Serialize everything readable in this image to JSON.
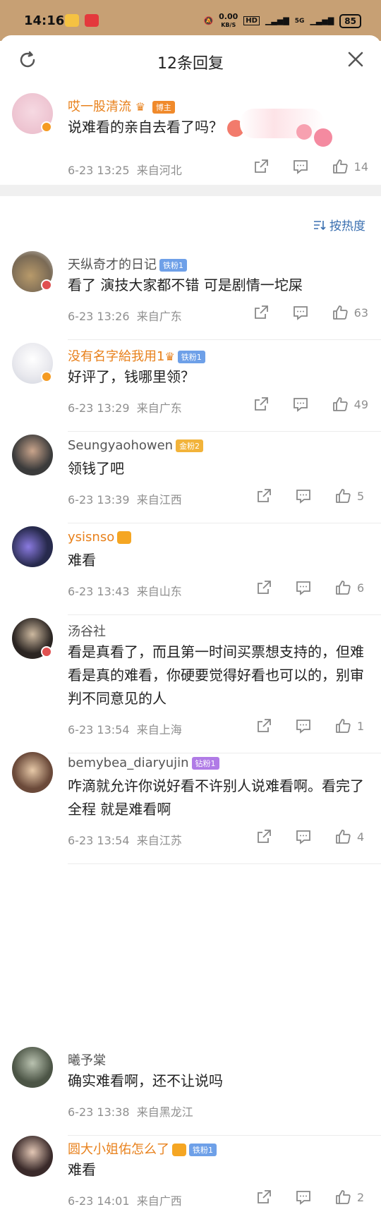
{
  "status_bar": {
    "time": "14:16",
    "net_speed": "0.00",
    "net_unit": "KB/S",
    "hd": "HD",
    "battery": "85",
    "signal_label": "5G"
  },
  "header": {
    "title": "12条回复"
  },
  "main_comment": {
    "name": "哎一股清流",
    "badge": "博主",
    "text": "说难看的亲自去看了吗？",
    "time": "6-23 13:25",
    "location": "来自河北",
    "likes": "14"
  },
  "sort_label": "按热度",
  "replies": [
    {
      "name": "天纵奇才的日记",
      "badge": "铁粉1",
      "text": "看了 演技大家都不错 可是剧情一坨屎",
      "time": "6-23 13:26",
      "location": "来自广东",
      "likes": "63"
    },
    {
      "name": "没有名字給我用1",
      "badge": "铁粉1",
      "text": "好评了，钱哪里领？",
      "time": "6-23 13:29",
      "location": "来自广东",
      "likes": "49"
    },
    {
      "name": "Seungyaohowen",
      "badge": "金粉2",
      "text": "领钱了吧",
      "time": "6-23 13:39",
      "location": "来自江西",
      "likes": "5"
    },
    {
      "name": "ysisnso",
      "badge": "",
      "text": "难看",
      "time": "6-23 13:43",
      "location": "来自山东",
      "likes": "6"
    },
    {
      "name": "汤谷社",
      "badge": "",
      "text": "看是真看了，而且第一时间买票想支持的，但难看是真的难看，你硬要觉得好看也可以的，别审判不同意见的人",
      "time": "6-23 13:54",
      "location": "来自上海",
      "likes": "1"
    },
    {
      "name": "bemybea_diaryujin",
      "badge": "钻粉1",
      "text": "咋滴就允许你说好看不许别人说难看啊。看完了全程 就是难看啊",
      "time": "6-23 13:54",
      "location": "来自江苏",
      "likes": "4"
    },
    {
      "name": "曦予棠",
      "badge": "",
      "text": "确实难看啊，还不让说吗",
      "time": "6-23 13:38",
      "location": "来自黑龙江",
      "likes": ""
    },
    {
      "name": "圆大小姐佑怎么了",
      "badge": "铁粉1",
      "text": "难看",
      "time": "6-23 14:01",
      "location": "来自广西",
      "likes": "2"
    }
  ],
  "colors": {
    "status_bar": "#c7a074",
    "orange_name": "#e8811c",
    "link_blue": "#3a6fb0",
    "meta_gray": "#8f8f8f"
  },
  "icons": [
    "refresh-icon",
    "close-icon",
    "repost-icon",
    "comment-icon",
    "like-icon",
    "sort-icon"
  ]
}
